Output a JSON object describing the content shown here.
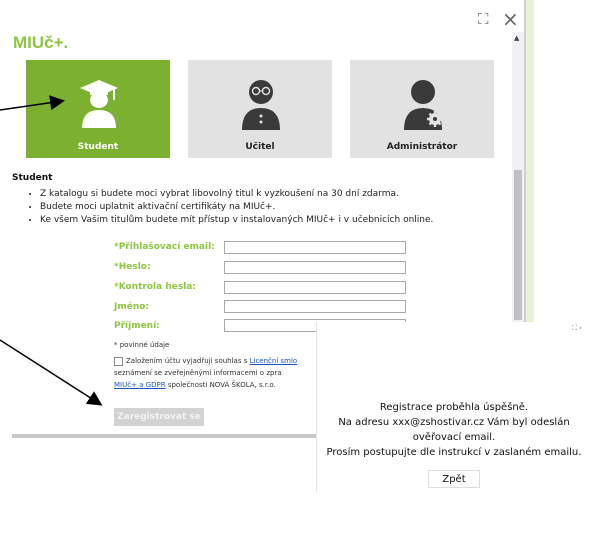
{
  "header": {
    "expand_icon": "⛶",
    "close_icon": "×"
  },
  "brand": "MIUč+.",
  "roles": [
    {
      "label": "Student",
      "icon": "student-icon",
      "active": true
    },
    {
      "label": "Učitel",
      "icon": "teacher-icon",
      "active": false
    },
    {
      "label": "Administrátor",
      "icon": "admin-icon",
      "active": false
    }
  ],
  "section": {
    "title": "Student",
    "bullets": [
      "Z katalogu si budete moci vybrat libovolný titul k vyzkoušení na 30 dní zdarma.",
      "Budete moci uplatnit aktivační certifikáty na MIUč+.",
      "Ke všem Vašim titulům budete mít přístup v instalovaných MIUč+ i v učebnicích online."
    ]
  },
  "form": {
    "email_label": "*Přihlašovací email:",
    "password_label": "*Heslo:",
    "password_check_label": "*Kontrola hesla:",
    "first_name_label": "Jméno:",
    "last_name_label": "Příjmení:",
    "required_note": "* povinné údaje",
    "consent_text_1": "Založením účtu vyjadřuji souhlas s",
    "consent_link_1": "Licenční smlo",
    "consent_text_2": "seznámení se zveřejněnými informacemi o zpra",
    "consent_link_2": "MIUč+ a GDPR",
    "consent_text_3": " společnosti NOVÁ ŠKOLA, s.r.o.",
    "register_button": "Zaregistrovat se"
  },
  "confirmation": {
    "icons": "⛶ ›",
    "line1": "Registrace proběhla úspěšně.",
    "line2": "Na adresu xxx@zshostivar.cz Vám byl odeslán",
    "line3": "ověřovací email.",
    "line4": "Prosím postupujte dle instrukcí v zaslaném emailu.",
    "back_button": "Zpět"
  },
  "colors": {
    "brand_green": "#8cc63f",
    "active_card": "#7bb12f",
    "inactive_card": "#e2e2e2",
    "dark_icon": "#3a3a3a"
  }
}
